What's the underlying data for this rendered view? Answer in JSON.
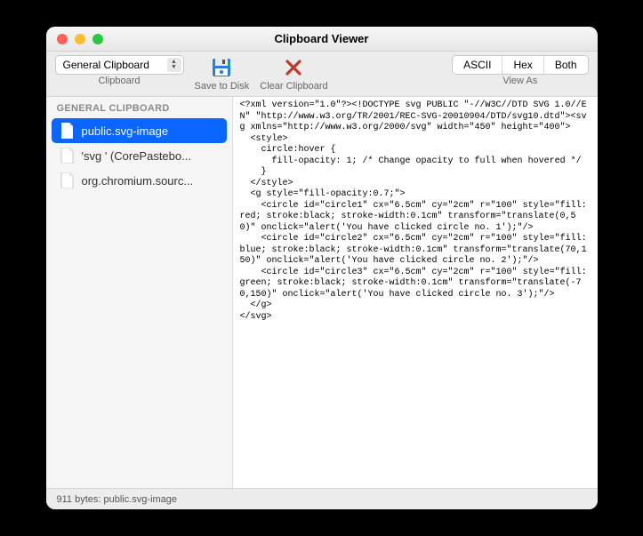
{
  "window": {
    "title": "Clipboard Viewer"
  },
  "toolbar": {
    "clipboard_selector": {
      "value": "General Clipboard",
      "label": "Clipboard"
    },
    "save": {
      "label": "Save to Disk"
    },
    "clear": {
      "label": "Clear Clipboard"
    },
    "viewas": {
      "label": "View As",
      "options": {
        "ascii": "ASCII",
        "hex": "Hex",
        "both": "Both"
      }
    }
  },
  "sidebar": {
    "header": "GENERAL CLIPBOARD",
    "items": [
      {
        "label": "public.svg-image",
        "selected": true
      },
      {
        "label": "'svg ' (CorePastebo...",
        "selected": false
      },
      {
        "label": "org.chromium.sourc...",
        "selected": false
      }
    ]
  },
  "detail": {
    "text": "<?xml version=\"1.0\"?><!DOCTYPE svg PUBLIC \"-//W3C//DTD SVG 1.0//EN\" \"http://www.w3.org/TR/2001/REC-SVG-20010904/DTD/svg10.dtd\"><svg xmlns=\"http://www.w3.org/2000/svg\" width=\"450\" height=\"400\">\n  <style>\n    circle:hover {\n      fill-opacity: 1; /* Change opacity to full when hovered */\n    }\n  </style>\n  <g style=\"fill-opacity:0.7;\">\n    <circle id=\"circle1\" cx=\"6.5cm\" cy=\"2cm\" r=\"100\" style=\"fill:red; stroke:black; stroke-width:0.1cm\" transform=\"translate(0,50)\" onclick=\"alert('You have clicked circle no. 1');\"/>\n    <circle id=\"circle2\" cx=\"6.5cm\" cy=\"2cm\" r=\"100\" style=\"fill:blue; stroke:black; stroke-width:0.1cm\" transform=\"translate(70,150)\" onclick=\"alert('You have clicked circle no. 2');\"/>\n    <circle id=\"circle3\" cx=\"6.5cm\" cy=\"2cm\" r=\"100\" style=\"fill:green; stroke:black; stroke-width:0.1cm\" transform=\"translate(-70,150)\" onclick=\"alert('You have clicked circle no. 3');\"/>\n  </g>\n</svg>"
  },
  "statusbar": {
    "text": "911 bytes: public.svg-image"
  }
}
